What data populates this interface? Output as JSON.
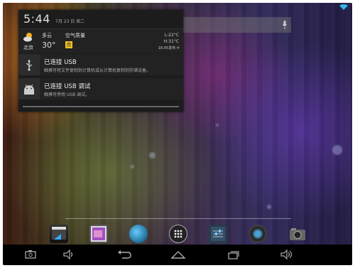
{
  "status": {
    "wifi_icon": "wifi-icon"
  },
  "notification_panel": {
    "time": "5:44",
    "date": "7月 23 日 周二",
    "weather": {
      "city": "北京",
      "condition": "多云",
      "temperature": "30°",
      "aq_label": "空气质量",
      "aq_level": "良",
      "low": "L:22°C",
      "high": "H:31°C",
      "updated": "16:05发布"
    },
    "notifications": [
      {
        "title": "已连接 USB",
        "text": "触摸可将文件复制到计算机或从计算机复制到存储设备。",
        "icon": "usb-icon"
      },
      {
        "title": "已连接 USB 调试",
        "text": "触摸可停用 USB 调试。",
        "icon": "android-icon"
      }
    ]
  },
  "search": {
    "placeholder": ""
  },
  "dock": {
    "apps": [
      {
        "name": "video-editor-app-icon"
      },
      {
        "name": "gallery-app-icon"
      },
      {
        "name": "browser-app-icon"
      },
      {
        "name": "app-launcher-icon"
      },
      {
        "name": "settings-app-icon"
      },
      {
        "name": "music-app-icon"
      },
      {
        "name": "camera-app-icon"
      }
    ]
  },
  "navigation": {
    "buttons": [
      "screenshot-icon",
      "volume-down-icon",
      "back-icon",
      "home-icon",
      "recent-apps-icon",
      "volume-up-icon"
    ]
  },
  "colors": {
    "panel": "#1c1c1c",
    "aq_badge": "#f0c020",
    "text": "#eeeeee"
  }
}
